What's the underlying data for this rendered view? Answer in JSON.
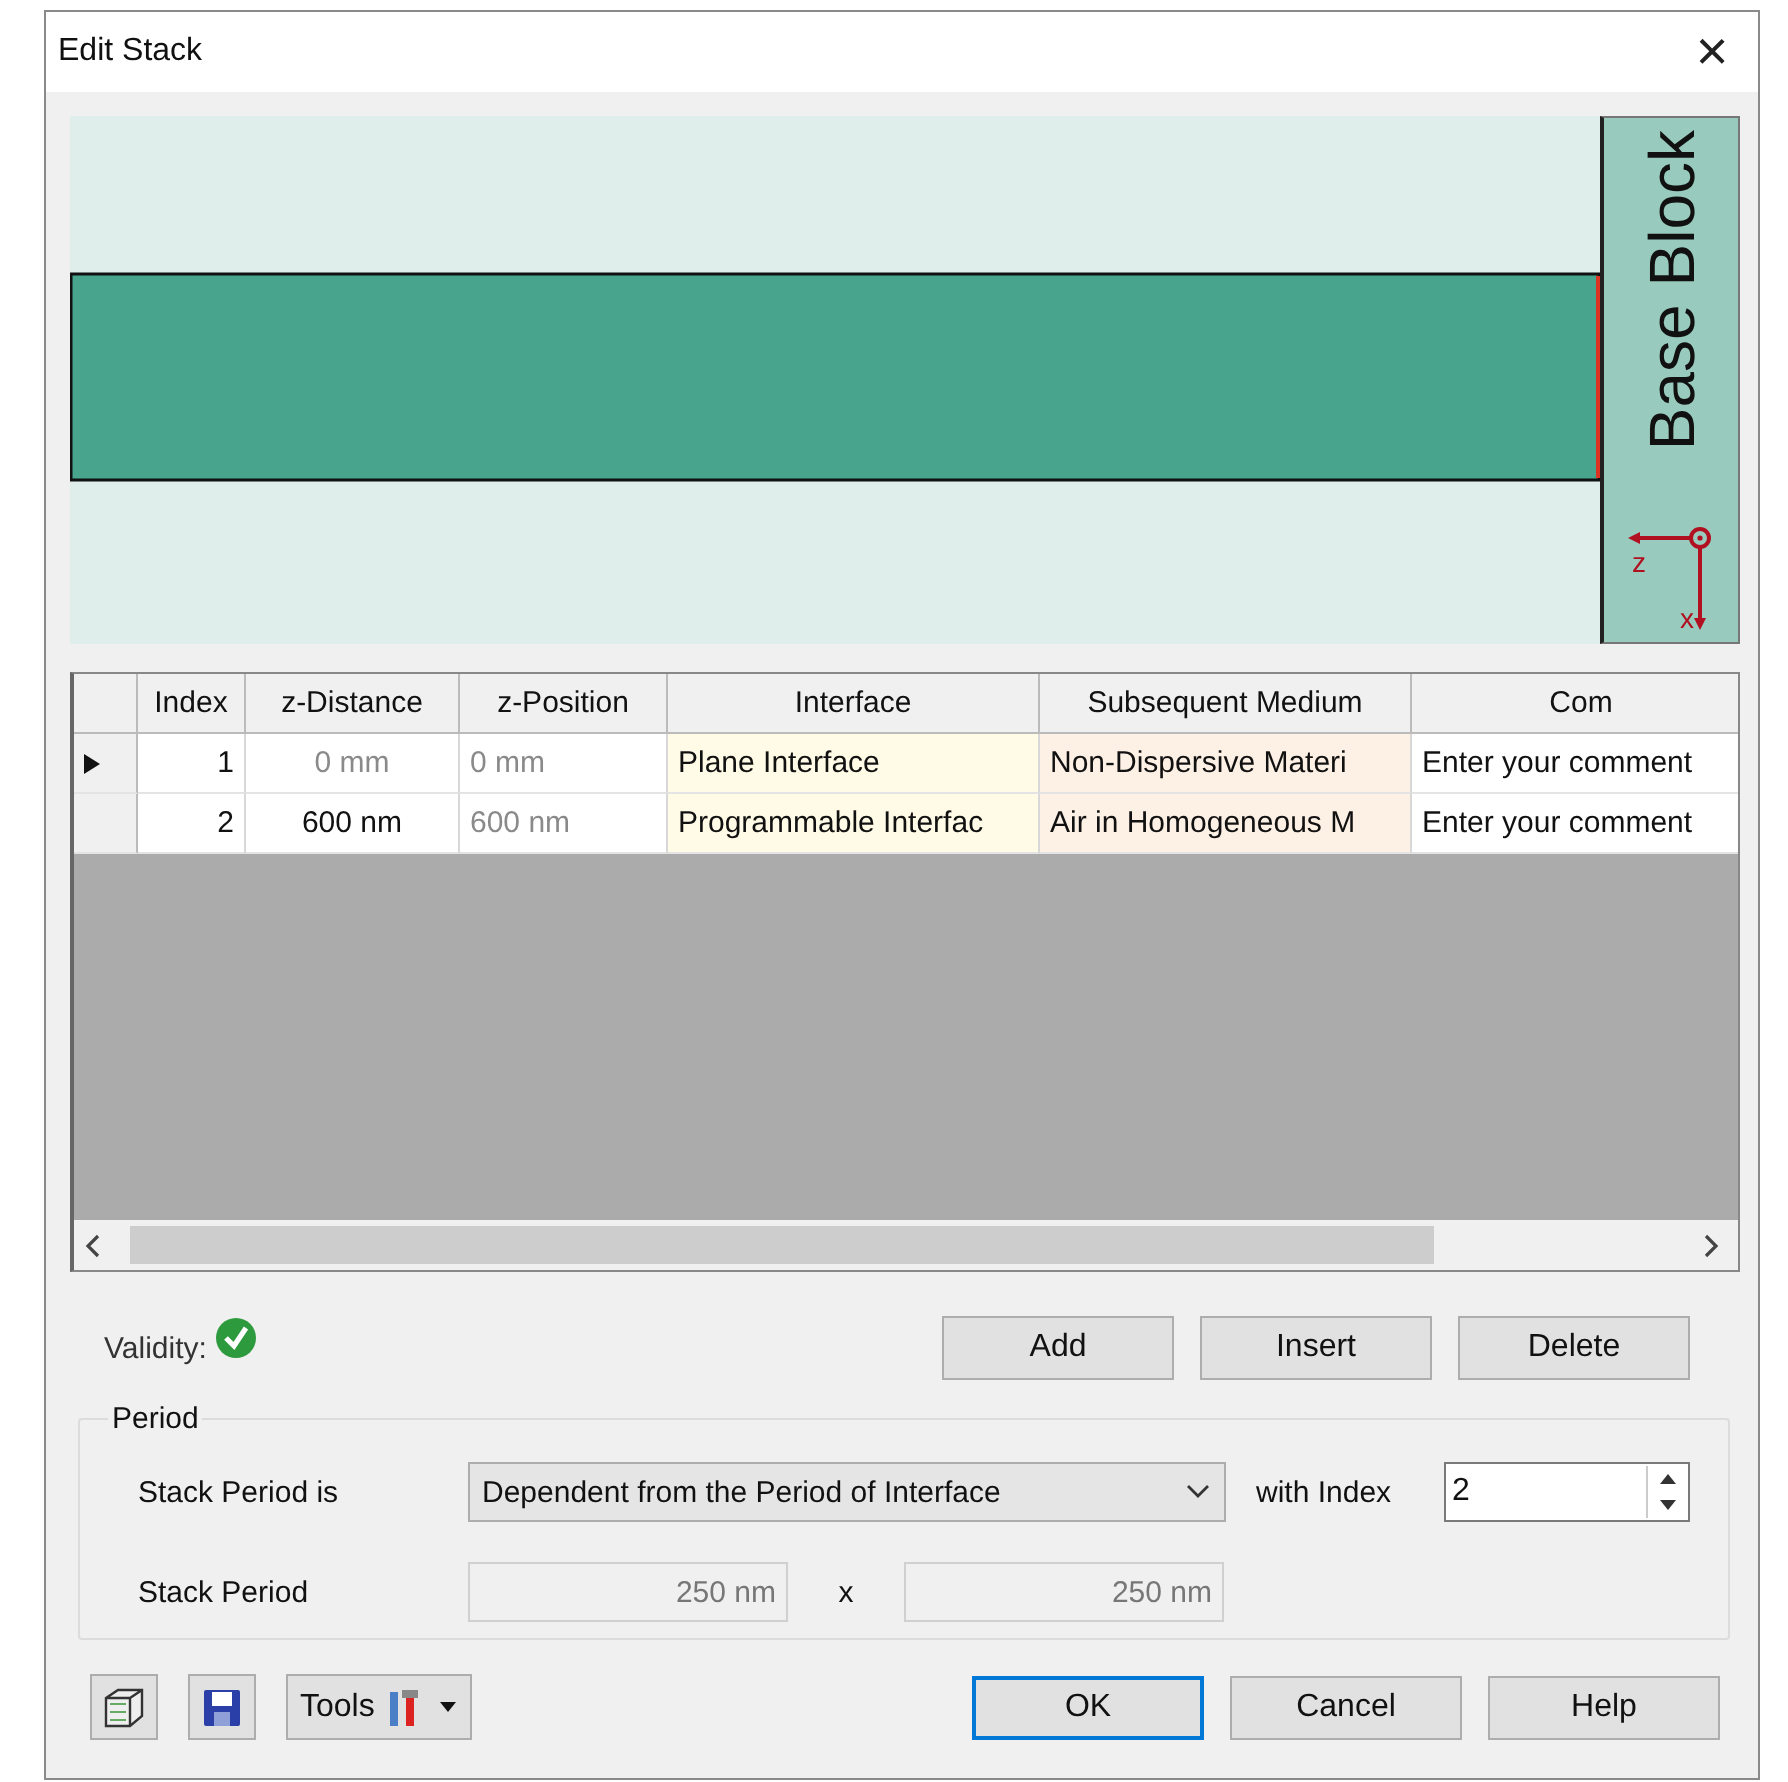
{
  "window": {
    "title": "Edit Stack",
    "close": "×"
  },
  "preview": {
    "block_label": "Base Block",
    "axes": [
      "z",
      "x"
    ]
  },
  "table": {
    "columns": [
      "Index",
      "z-Distance",
      "z-Position",
      "Interface",
      "Subsequent Medium",
      "Com"
    ],
    "rows": [
      {
        "selected": true,
        "distance_editable": false,
        "cells": [
          "1",
          "0 mm",
          "0 mm",
          "Plane Interface",
          "Non-Dispersive Materi",
          "Enter your comment"
        ]
      },
      {
        "selected": false,
        "distance_editable": true,
        "cells": [
          "2",
          "600 nm",
          "600 nm",
          "Programmable Interfac",
          "Air in Homogeneous M",
          "Enter your comment"
        ]
      }
    ]
  },
  "validity": {
    "label": "Validity:",
    "valid": true
  },
  "row_buttons": [
    "Add",
    "Insert",
    "Delete"
  ],
  "period": {
    "title": "Period",
    "mode_label": "Stack Period is",
    "mode_value": "Dependent from the Period of Interface",
    "index_label": "with Index",
    "index_value": "2",
    "period_label": "Stack Period",
    "period_x": "250 nm",
    "times": "x",
    "period_y": "250 nm"
  },
  "footer": {
    "tools": "Tools",
    "buttons": [
      {
        "label": "OK",
        "default": true
      },
      {
        "label": "Cancel",
        "default": false
      },
      {
        "label": "Help",
        "default": false
      }
    ]
  }
}
